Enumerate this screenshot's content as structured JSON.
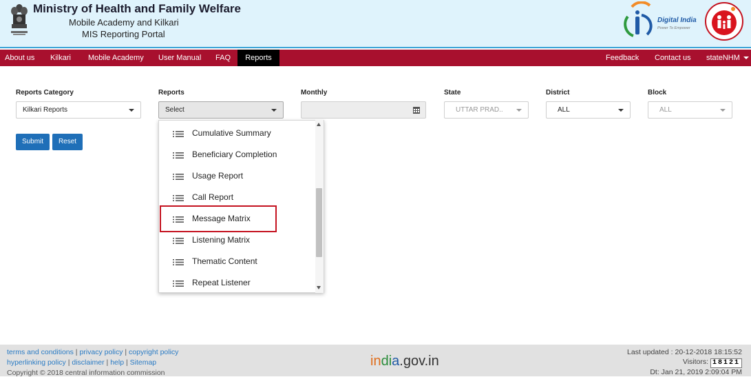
{
  "header": {
    "title": "Ministry of Health and Family Welfare",
    "subtitle_1": "Mobile Academy and Kilkari",
    "subtitle_2": "MIS Reporting Portal",
    "digital_india_text": "Digital India",
    "digital_india_tagline": "Power To Empower"
  },
  "nav": {
    "items": [
      {
        "label": "About us"
      },
      {
        "label": "Kilkari"
      },
      {
        "label": "Mobile Academy"
      },
      {
        "label": "User Manual"
      },
      {
        "label": "FAQ"
      },
      {
        "label": "Reports",
        "active": true
      }
    ],
    "right_items": [
      {
        "label": "Feedback"
      },
      {
        "label": "Contact us"
      },
      {
        "label": "stateNHM"
      }
    ],
    "bar_color": "#a8102e"
  },
  "form": {
    "reports_category": {
      "label": "Reports Category",
      "value": "Kilkari Reports"
    },
    "reports": {
      "label": "Reports",
      "value": "Select"
    },
    "monthly": {
      "label": "Monthly",
      "value": ""
    },
    "state": {
      "label": "State",
      "value": "UTTAR PRAD.."
    },
    "district": {
      "label": "District",
      "value": "ALL"
    },
    "block": {
      "label": "Block",
      "value": "ALL"
    },
    "submit_label": "Submit",
    "reset_label": "Reset"
  },
  "dropdown": {
    "items": [
      "Cumulative Summary",
      "Beneficiary Completion",
      "Usage Report",
      "Call Report",
      "Message Matrix",
      "Listening Matrix",
      "Thematic Content",
      "Repeat Listener"
    ],
    "highlighted": "Message Matrix",
    "highlight_color": "#c4121f"
  },
  "footer": {
    "links_row1": [
      "terms and conditions",
      "privacy policy",
      "copyright policy"
    ],
    "links_row2": [
      "hyperlinking policy",
      "disclaimer",
      "help",
      "Sitemap"
    ],
    "copyright": "Copyright © 2018 central information commission",
    "india_gov_1": "in",
    "india_gov_2": "di",
    "india_gov_3": "a",
    "india_gov_4": ".gov.in",
    "last_updated": "Last updated : 20-12-2018 18:15:52",
    "visitors_label": "Visitors:",
    "visitors_count": "18121",
    "date_time": "Dt: Jan 21, 2019 2:09:04 PM"
  }
}
